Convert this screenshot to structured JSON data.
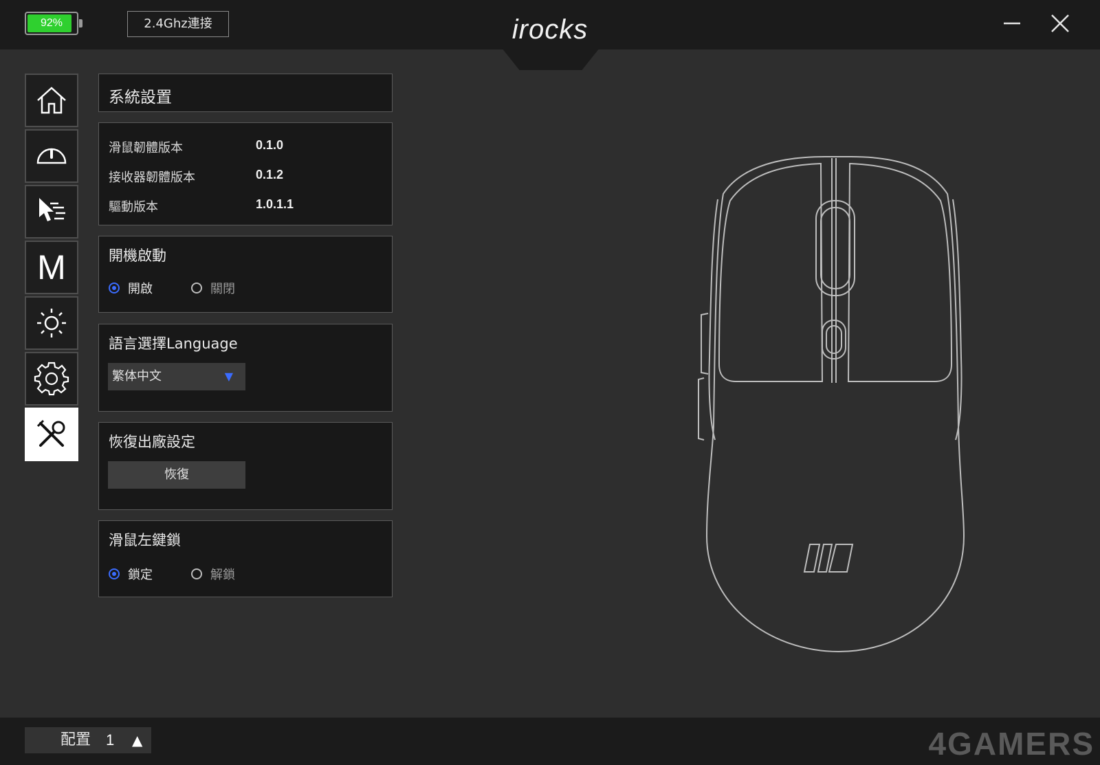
{
  "header": {
    "battery": {
      "text": "92%",
      "level": 0.92
    },
    "connection": "2.4Ghz連接",
    "logo": "irocks"
  },
  "sidebar": {
    "items": [
      {
        "icon": "home-icon"
      },
      {
        "icon": "performance-gauge-icon"
      },
      {
        "icon": "button-assign-icon"
      },
      {
        "icon": "macro-icon",
        "text": "M"
      },
      {
        "icon": "lighting-icon"
      },
      {
        "icon": "settings-gear-icon"
      },
      {
        "icon": "tools-icon",
        "active": true
      }
    ]
  },
  "system": {
    "title": "系統設置",
    "versions": [
      {
        "label": "滑鼠韌體版本",
        "value": "0.1.0"
      },
      {
        "label": "接收器韌體版本",
        "value": "0.1.2"
      },
      {
        "label": "驅動版本",
        "value": "1.0.1.1"
      }
    ]
  },
  "startup": {
    "title": "開機啟動",
    "on": "開啟",
    "off": "關閉",
    "selected": "on"
  },
  "language": {
    "title": "語言選擇Language",
    "selected": "繁体中文"
  },
  "reset": {
    "title": "恢復出廠設定",
    "button": "恢復"
  },
  "left_lock": {
    "title": "滑鼠左鍵鎖",
    "lock": "鎖定",
    "unlock": "解鎖",
    "selected": "lock"
  },
  "footer": {
    "profile_label": "配置",
    "profile_number": "1",
    "watermark": "4GAMERS"
  },
  "colors": {
    "accent": "#3b6cff",
    "battery": "#2fd02f",
    "background": "#2e2e2e",
    "bar": "#1b1b1b"
  }
}
